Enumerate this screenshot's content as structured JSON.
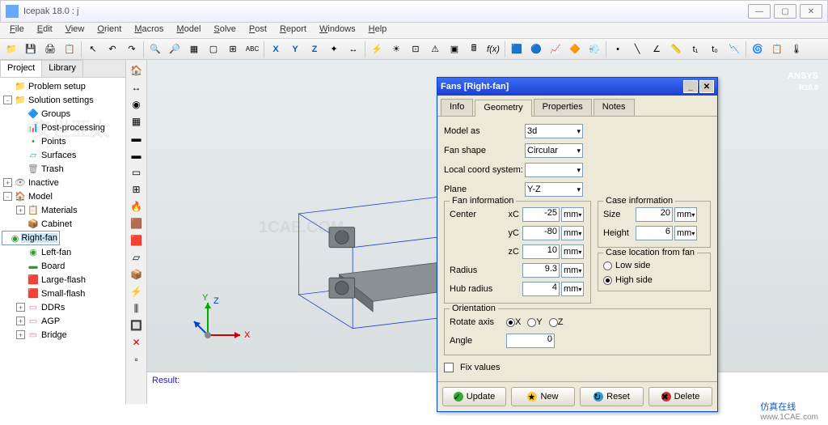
{
  "window": {
    "title": "Icepak 18.0 : j"
  },
  "menu": [
    "File",
    "Edit",
    "View",
    "Orient",
    "Macros",
    "Model",
    "Solve",
    "Post",
    "Report",
    "Windows",
    "Help"
  ],
  "sidebar_tabs": {
    "active": "Project",
    "other": "Library"
  },
  "tree": [
    {
      "lvl": 1,
      "exp": "",
      "ico": "📁",
      "label": "Problem setup",
      "col": "#c90"
    },
    {
      "lvl": 1,
      "exp": "-",
      "ico": "📁",
      "label": "Solution settings",
      "col": "#c90"
    },
    {
      "lvl": 2,
      "exp": "",
      "ico": "🔷",
      "label": "Groups",
      "col": "#39c"
    },
    {
      "lvl": 2,
      "exp": "",
      "ico": "📊",
      "label": "Post-processing",
      "col": "#c66"
    },
    {
      "lvl": 2,
      "exp": "",
      "ico": "•",
      "label": "Points",
      "col": "#393"
    },
    {
      "lvl": 2,
      "exp": "",
      "ico": "▱",
      "label": "Surfaces",
      "col": "#39c"
    },
    {
      "lvl": 2,
      "exp": "",
      "ico": "🗑",
      "label": "Trash",
      "col": "#888"
    },
    {
      "lvl": 1,
      "exp": "+",
      "ico": "👁",
      "label": "Inactive",
      "col": "#888"
    },
    {
      "lvl": 1,
      "exp": "-",
      "ico": "🏠",
      "label": "Model",
      "col": "#c66"
    },
    {
      "lvl": 2,
      "exp": "+",
      "ico": "📋",
      "label": "Materials",
      "col": "#c90"
    },
    {
      "lvl": 2,
      "exp": "",
      "ico": "📦",
      "label": "Cabinet",
      "col": "#c66"
    },
    {
      "lvl": 2,
      "exp": "",
      "ico": "◉",
      "label": "Right-fan",
      "col": "#393",
      "sel": true
    },
    {
      "lvl": 2,
      "exp": "",
      "ico": "◉",
      "label": "Left-fan",
      "col": "#393"
    },
    {
      "lvl": 2,
      "exp": "",
      "ico": "▬",
      "label": "Board",
      "col": "#393"
    },
    {
      "lvl": 2,
      "exp": "",
      "ico": "🟥",
      "label": "Large-flash",
      "col": "#c33"
    },
    {
      "lvl": 2,
      "exp": "",
      "ico": "🟥",
      "label": "Small-flash",
      "col": "#c33"
    },
    {
      "lvl": 2,
      "exp": "+",
      "ico": "▭",
      "label": "DDRs",
      "col": "#e7a"
    },
    {
      "lvl": 2,
      "exp": "+",
      "ico": "▭",
      "label": "AGP",
      "col": "#e7a"
    },
    {
      "lvl": 2,
      "exp": "+",
      "ico": "▭",
      "label": "Bridge",
      "col": "#e7a"
    }
  ],
  "branding": {
    "name": "ANSYS",
    "ver": "R18.0"
  },
  "result_label": "Result:",
  "dialog": {
    "title": "Fans [Right-fan]",
    "tabs": [
      "Info",
      "Geometry",
      "Properties",
      "Notes"
    ],
    "active_tab": "Geometry",
    "model_as": {
      "label": "Model as",
      "value": "3d"
    },
    "fan_shape": {
      "label": "Fan shape",
      "value": "Circular"
    },
    "coord": {
      "label": "Local coord system:",
      "value": ""
    },
    "plane": {
      "label": "Plane",
      "value": "Y-Z"
    },
    "fan_info": {
      "legend": "Fan information",
      "center": "Center",
      "xc": {
        "label": "xC",
        "value": "-25",
        "unit": "mm"
      },
      "yc": {
        "label": "yC",
        "value": "-80",
        "unit": "mm"
      },
      "zc": {
        "label": "zC",
        "value": "10",
        "unit": "mm"
      },
      "radius": {
        "label": "Radius",
        "value": "9.3",
        "unit": "mm"
      },
      "hub": {
        "label": "Hub radius",
        "value": "4",
        "unit": "mm"
      }
    },
    "case_info": {
      "legend": "Case information",
      "size": {
        "label": "Size",
        "value": "20",
        "unit": "mm"
      },
      "height": {
        "label": "Height",
        "value": "6",
        "unit": "mm"
      }
    },
    "case_loc": {
      "legend": "Case location from fan",
      "low": "Low side",
      "high": "High side"
    },
    "orientation": {
      "legend": "Orientation",
      "rotate": "Rotate axis",
      "x": "X",
      "y": "Y",
      "z": "Z",
      "angle": {
        "label": "Angle",
        "value": "0"
      }
    },
    "fix_values": "Fix values",
    "buttons": {
      "update": "Update",
      "new": "New",
      "reset": "Reset",
      "delete": "Delete"
    }
  },
  "axes": {
    "x": "X",
    "y": "Y",
    "z": "Z"
  },
  "watermark": "安世亚太",
  "footer": {
    "cn": "仿真在线",
    "url": "www.1CAE.com"
  }
}
